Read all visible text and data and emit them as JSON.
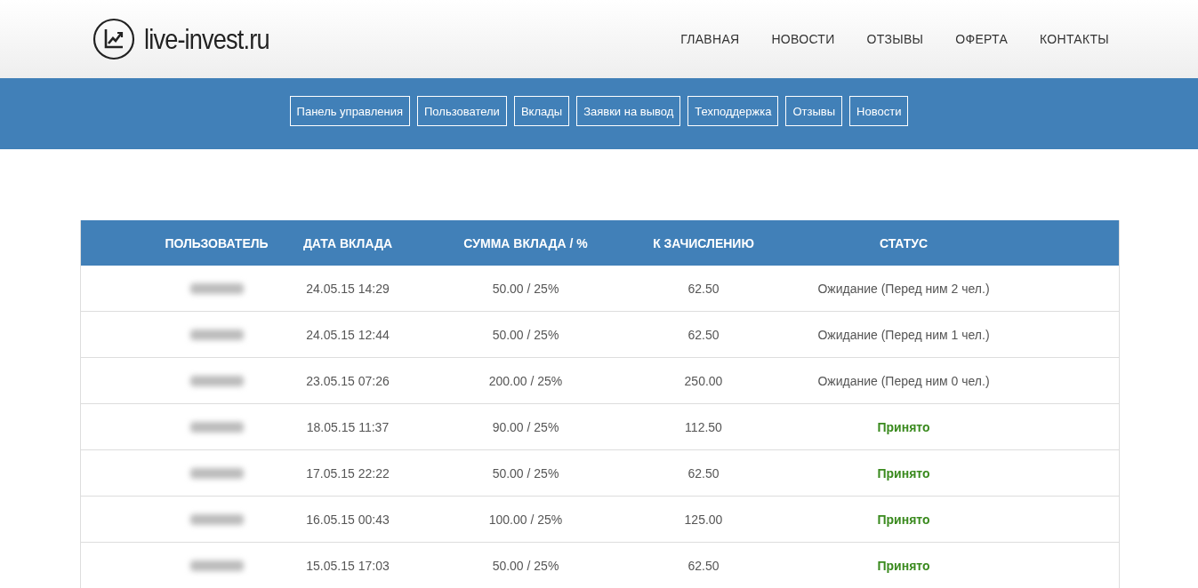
{
  "site": {
    "logo_text": "live-invest.ru"
  },
  "main_nav": [
    {
      "label": "ГЛАВНАЯ"
    },
    {
      "label": "НОВОСТИ"
    },
    {
      "label": "ОТЗЫВЫ"
    },
    {
      "label": "ОФЕРТА"
    },
    {
      "label": "КОНТАКТЫ"
    }
  ],
  "admin_nav": [
    {
      "label": "Панель управления"
    },
    {
      "label": "Пользователи"
    },
    {
      "label": "Вклады"
    },
    {
      "label": "Заявки на вывод"
    },
    {
      "label": "Техподдержка"
    },
    {
      "label": "Отзывы"
    },
    {
      "label": "Новости"
    }
  ],
  "table": {
    "columns": [
      "ПОЛЬЗОВАТЕЛЬ",
      "ДАТА ВКЛАДА",
      "СУММА ВКЛАДА / %",
      "К ЗАЧИСЛЕНИЮ",
      "СТАТУС"
    ],
    "rows": [
      {
        "date": "24.05.15 14:29",
        "amount": "50.00 / 25%",
        "credit": "62.50",
        "status": "Ожидание (Перед ним 2 чел.)",
        "kind": "waiting"
      },
      {
        "date": "24.05.15 12:44",
        "amount": "50.00 / 25%",
        "credit": "62.50",
        "status": "Ожидание (Перед ним 1 чел.)",
        "kind": "waiting"
      },
      {
        "date": "23.05.15 07:26",
        "amount": "200.00 / 25%",
        "credit": "250.00",
        "status": "Ожидание (Перед ним 0 чел.)",
        "kind": "waiting"
      },
      {
        "date": "18.05.15 11:37",
        "amount": "90.00 / 25%",
        "credit": "112.50",
        "status": "Принято",
        "kind": "accepted"
      },
      {
        "date": "17.05.15 22:22",
        "amount": "50.00 / 25%",
        "credit": "62.50",
        "status": "Принято",
        "kind": "accepted"
      },
      {
        "date": "16.05.15 00:43",
        "amount": "100.00 / 25%",
        "credit": "125.00",
        "status": "Принято",
        "kind": "accepted"
      },
      {
        "date": "15.05.15 17:03",
        "amount": "50.00 / 25%",
        "credit": "62.50",
        "status": "Принято",
        "kind": "accepted"
      }
    ]
  }
}
